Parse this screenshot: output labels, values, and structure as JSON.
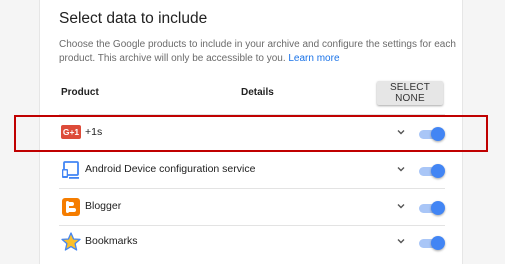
{
  "header": {
    "title": "Select data to include",
    "description": "Choose the Google products to include in your archive and configure the settings for each product. This archive will only be accessible to you.",
    "learn_more": "Learn more"
  },
  "table": {
    "col_product": "Product",
    "col_details": "Details",
    "select_none_label": "SELECT NONE"
  },
  "products": [
    {
      "label": "+1s",
      "icon": "gplus-icon",
      "icon_text": "G+1",
      "enabled": true,
      "highlighted": true
    },
    {
      "label": "Android Device configuration service",
      "icon": "android-device-icon",
      "enabled": true
    },
    {
      "label": "Blogger",
      "icon": "blogger-icon",
      "icon_text": "B",
      "enabled": true
    },
    {
      "label": "Bookmarks",
      "icon": "star-icon",
      "enabled": true
    }
  ],
  "colors": {
    "accent": "#4285f4",
    "highlight_border": "#c00000",
    "gplus_red": "#dd4b39",
    "blogger_orange": "#f57d00"
  }
}
